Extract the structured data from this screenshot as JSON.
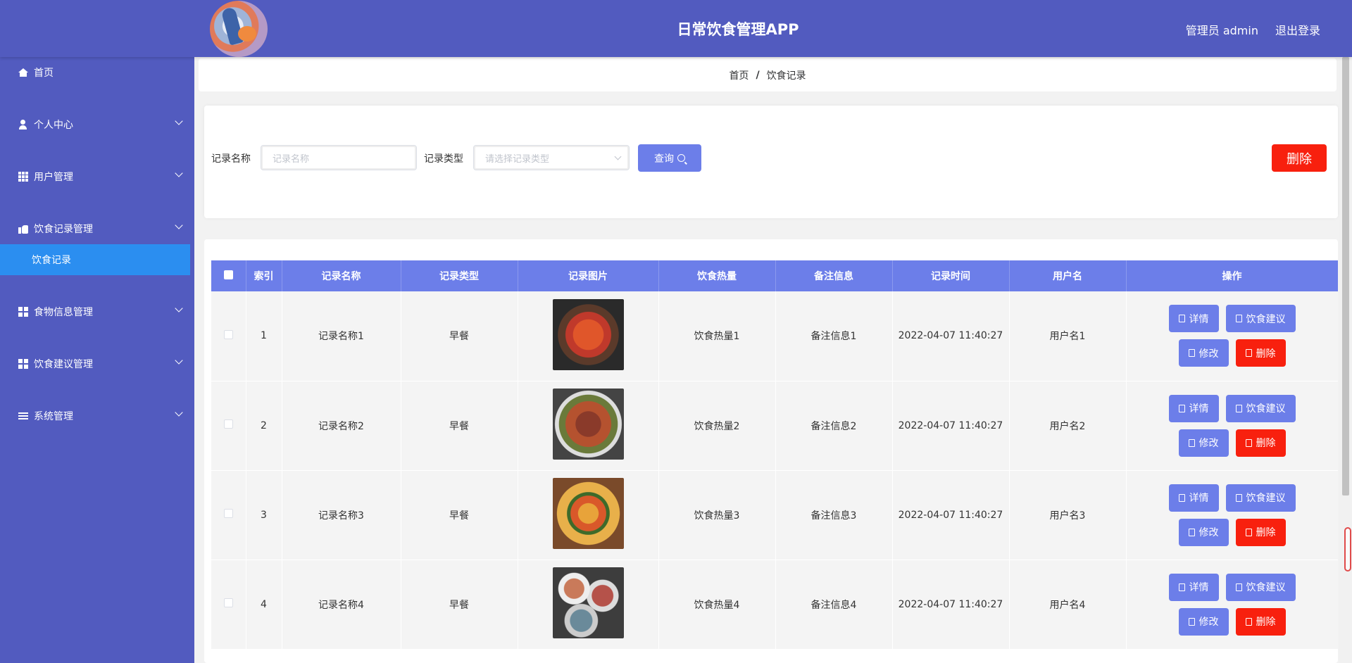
{
  "header": {
    "title": "日常饮食管理APP",
    "admin_label": "管理员 admin",
    "logout_label": "退出登录"
  },
  "sidebar": {
    "items": [
      {
        "label": "首页",
        "icon": "home-icon"
      },
      {
        "label": "个人中心",
        "icon": "user-icon"
      },
      {
        "label": "用户管理",
        "icon": "grid-icon"
      },
      {
        "label": "饮食记录管理",
        "icon": "thumb-icon"
      },
      {
        "label": "食物信息管理",
        "icon": "apps-icon"
      },
      {
        "label": "饮食建议管理",
        "icon": "apps-icon"
      },
      {
        "label": "系统管理",
        "icon": "menu-icon"
      }
    ],
    "active_sub": "饮食记录"
  },
  "breadcrumb": {
    "home": "首页",
    "sep": "/",
    "current": "饮食记录"
  },
  "search": {
    "name_label": "记录名称",
    "name_placeholder": "记录名称",
    "type_label": "记录类型",
    "type_placeholder": "请选择记录类型",
    "query_label": "查询",
    "delete_label": "删除"
  },
  "table": {
    "headers": [
      "索引",
      "记录名称",
      "记录类型",
      "记录图片",
      "饮食热量",
      "备注信息",
      "记录时间",
      "用户名",
      "操作"
    ],
    "rows": [
      {
        "index": "1",
        "name": "记录名称1",
        "type": "早餐",
        "calories": "饮食热量1",
        "note": "备注信息1",
        "time": "2022-04-07 11:40:27",
        "user": "用户名1",
        "image": "crab-dish"
      },
      {
        "index": "2",
        "name": "记录名称2",
        "type": "早餐",
        "calories": "饮食热量2",
        "note": "备注信息2",
        "time": "2022-04-07 11:40:27",
        "user": "用户名2",
        "image": "stir-fry-dish"
      },
      {
        "index": "3",
        "name": "记录名称3",
        "type": "早餐",
        "calories": "饮食热量3",
        "note": "备注信息3",
        "time": "2022-04-07 11:40:27",
        "user": "用户名3",
        "image": "pizza"
      },
      {
        "index": "4",
        "name": "记录名称4",
        "type": "早餐",
        "calories": "饮食热量4",
        "note": "备注信息4",
        "time": "2022-04-07 11:40:27",
        "user": "用户名4",
        "image": "bowls-dish"
      }
    ],
    "actions": {
      "detail": "详情",
      "advice": "饮食建议",
      "edit": "修改",
      "delete": "删除"
    }
  },
  "colors": {
    "primary": "#525bbf",
    "accent": "#6c7ee9",
    "active": "#2b8ef0",
    "danger": "#f8200e"
  }
}
